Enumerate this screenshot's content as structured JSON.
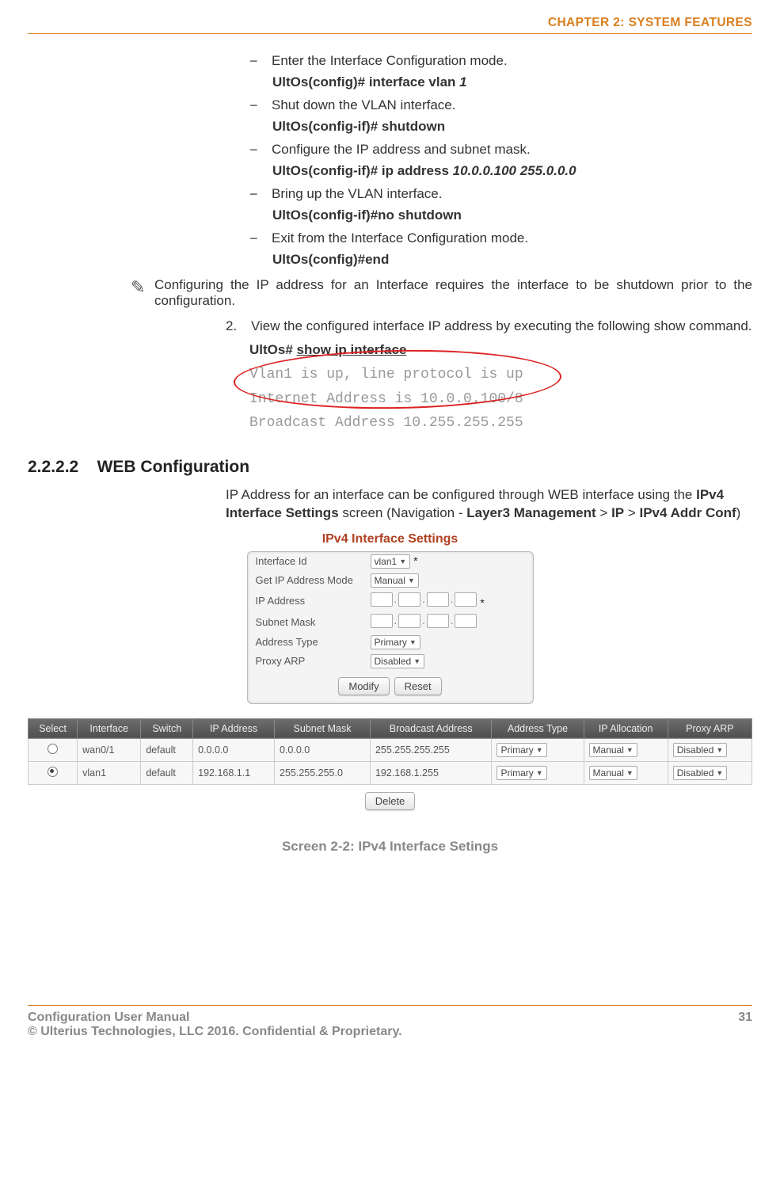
{
  "header": {
    "chapter": "CHAPTER 2: SYSTEM FEATURES"
  },
  "steps": [
    {
      "text": "Enter the Interface Configuration mode.",
      "cmd_bold": "UltOs(config)# interface vlan ",
      "cmd_ital": "1"
    },
    {
      "text": "Shut down the VLAN interface.",
      "cmd_bold": "UltOs(config-if)# shutdown",
      "cmd_ital": ""
    },
    {
      "text": "Configure the IP address and subnet mask.",
      "cmd_bold": "UltOs(config-if)# ip address ",
      "cmd_ital": "10.0.0.100  255.0.0.0"
    },
    {
      "text": "Bring up the VLAN interface.",
      "cmd_bold": "UltOs(config-if)#no shutdown",
      "cmd_ital": ""
    },
    {
      "text": "Exit from the Interface Configuration mode.",
      "cmd_bold": "UltOs(config)#end",
      "cmd_ital": ""
    }
  ],
  "note": "Configuring the IP address for an Interface requires the interface to be shutdown prior to the configuration.",
  "numbered": {
    "num": "2.",
    "text": "View the configured interface IP address by executing the following show command."
  },
  "show_cmd": {
    "prefix": "UltOs# ",
    "under": "show ip interface"
  },
  "output": {
    "l1": "Vlan1 is up, line protocol is up",
    "l2": "Internet Address is 10.0.0.100/8",
    "l3": "Broadcast Address 10.255.255.255"
  },
  "section": {
    "num": "2.2.2.2",
    "title": "WEB Configuration"
  },
  "para": {
    "p1": "IP Address for an interface can be configured through WEB interface using the ",
    "b1": "IPv4 Interface Settings",
    "p2": " screen (Navigation - ",
    "b2": "Layer3 Management",
    "p3": " > ",
    "b3": "IP",
    "p4": " > ",
    "b4": "IPv4 Addr Conf",
    "p5": ")"
  },
  "panel": {
    "title": "IPv4 Interface Settings",
    "rows": {
      "iface_label": "Interface Id",
      "iface_val": "vlan1",
      "mode_label": "Get IP Address Mode",
      "mode_val": "Manual",
      "ip_label": "IP Address",
      "mask_label": "Subnet Mask",
      "type_label": "Address Type",
      "type_val": "Primary",
      "proxy_label": "Proxy ARP",
      "proxy_val": "Disabled"
    },
    "buttons": {
      "modify": "Modify",
      "reset": "Reset"
    }
  },
  "table": {
    "headers": [
      "Select",
      "Interface",
      "Switch",
      "IP Address",
      "Subnet Mask",
      "Broadcast Address",
      "Address Type",
      "IP Allocation",
      "Proxy ARP"
    ],
    "rows": [
      {
        "sel": false,
        "iface": "wan0/1",
        "switch": "default",
        "ip": "0.0.0.0",
        "mask": "0.0.0.0",
        "bcast": "255.255.255.255",
        "type": "Primary",
        "alloc": "Manual",
        "proxy": "Disabled"
      },
      {
        "sel": true,
        "iface": "vlan1",
        "switch": "default",
        "ip": "192.168.1.1",
        "mask": "255.255.255.0",
        "bcast": "192.168.1.255",
        "type": "Primary",
        "alloc": "Manual",
        "proxy": "Disabled"
      }
    ],
    "delete": "Delete"
  },
  "caption": "Screen 2-2: IPv4 Interface Setings",
  "footer": {
    "left1": "Configuration User Manual",
    "right": "31",
    "left2": "© Ulterius Technologies, LLC 2016. Confidential & Proprietary."
  }
}
